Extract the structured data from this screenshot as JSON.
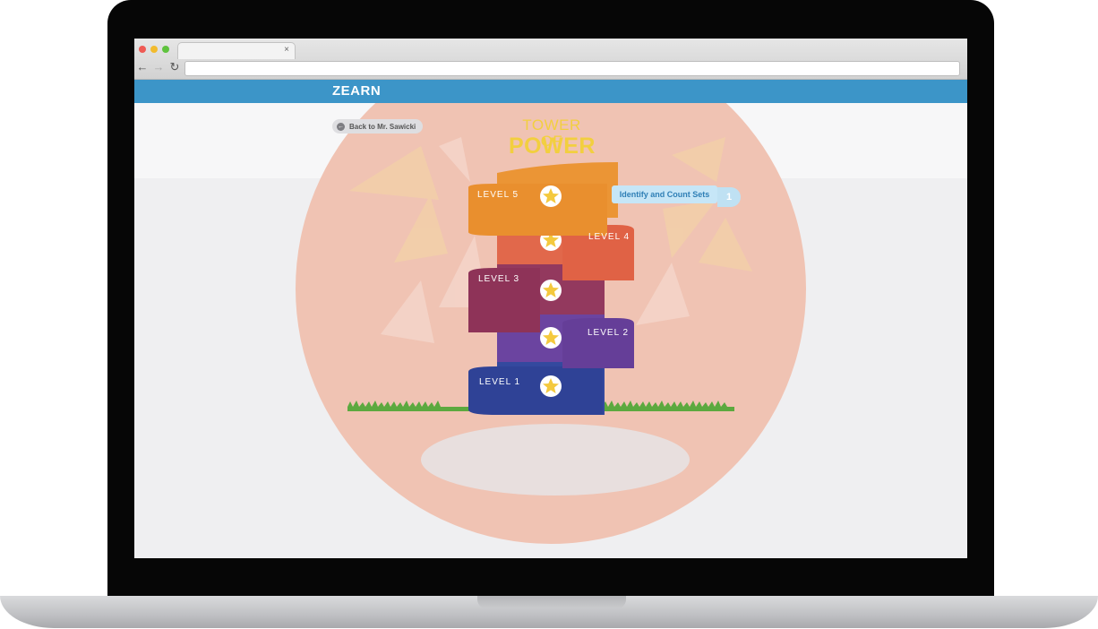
{
  "browser": {
    "tab_close": "×",
    "nav": {
      "back": "←",
      "forward": "→",
      "reload": "↻"
    },
    "address_value": ""
  },
  "app": {
    "logo": "ZEARN",
    "back_button": "Back to Mr. Sawicki",
    "title_line1": "TOWER OF",
    "title_line2": "POWER"
  },
  "levels": [
    {
      "label": "LEVEL 5",
      "color": "#e98f2e"
    },
    {
      "label": "LEVEL 4",
      "color": "#e06245"
    },
    {
      "label": "LEVEL 3",
      "color": "#8e3358"
    },
    {
      "label": "LEVEL 2",
      "color": "#653e98"
    },
    {
      "label": "LEVEL 1",
      "color": "#2f4296"
    }
  ],
  "lesson_tooltip": {
    "text": "Identify and Count Sets",
    "count": "1"
  },
  "colors": {
    "header": "#3c95c8",
    "title": "#f2cf3f",
    "sun": "#f0c3b3",
    "star": "#f4c93e"
  }
}
